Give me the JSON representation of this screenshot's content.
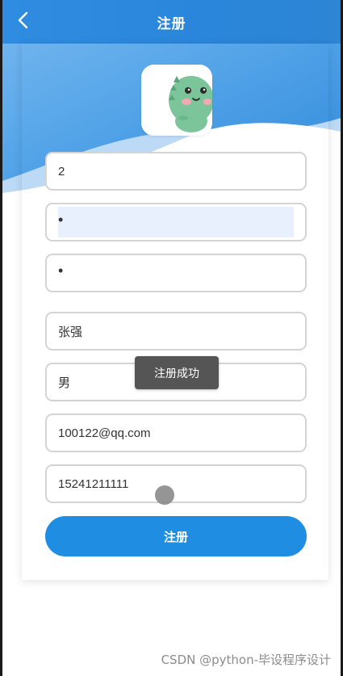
{
  "header": {
    "title": "注册"
  },
  "form": {
    "username": "2",
    "password": "•",
    "confirm_password": "•",
    "name": "张强",
    "gender": "男",
    "email": "100122@qq.com",
    "phone": "15241211111"
  },
  "toast": {
    "message": "注册成功"
  },
  "submit": {
    "label": "注册"
  },
  "watermark": {
    "text": "CSDN @python-毕设程序设计"
  },
  "colors": {
    "primary": "#1f8de2",
    "header": "#2a86da",
    "field_border": "#d4d4d4",
    "toast_bg": "#555555",
    "autofill": "#e8f0fe"
  },
  "icons": {
    "back": "chevron-left-icon",
    "avatar": "dinosaur-mascot"
  }
}
